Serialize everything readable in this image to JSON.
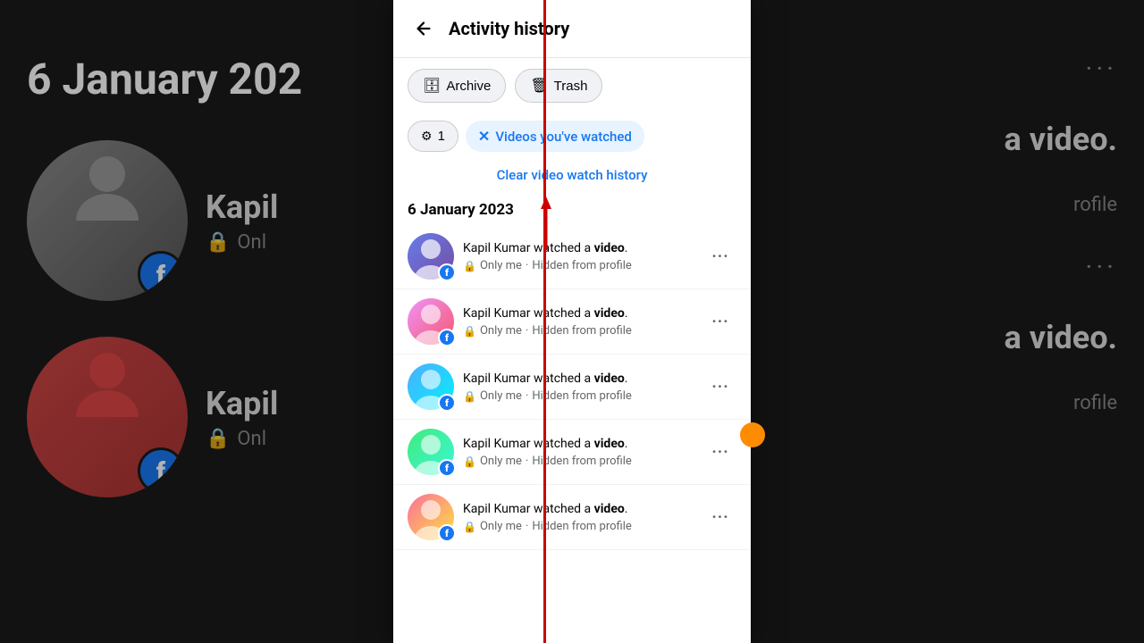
{
  "header": {
    "back_label": "←",
    "title": "Activity history"
  },
  "action_buttons": [
    {
      "id": "archive",
      "icon": "🗄",
      "label": "Archive"
    },
    {
      "id": "trash",
      "icon": "🗑",
      "label": "Trash"
    }
  ],
  "filter": {
    "count": "1",
    "filter_icon": "⚙",
    "tag_label": "Videos you've watched",
    "tag_x": "✕"
  },
  "clear_link": "Clear video watch history",
  "date_label": "6 January 2023",
  "activities": [
    {
      "id": 1,
      "text_prefix": "Kapil Kumar watched a",
      "text_bold": "video",
      "text_suffix": ".",
      "meta_lock": "🔒",
      "meta_visibility": "Only me",
      "meta_sep": "·",
      "meta_hidden": "Hidden from profile",
      "more": "···"
    },
    {
      "id": 2,
      "text_prefix": "Kapil Kumar watched a",
      "text_bold": "video",
      "text_suffix": ".",
      "meta_lock": "🔒",
      "meta_visibility": "Only me",
      "meta_sep": "·",
      "meta_hidden": "Hidden from profile",
      "more": "···"
    },
    {
      "id": 3,
      "text_prefix": "Kapil Kumar watched a",
      "text_bold": "video",
      "text_suffix": ".",
      "meta_lock": "🔒",
      "meta_visibility": "Only me",
      "meta_sep": "·",
      "meta_hidden": "Hidden from profile",
      "more": "···"
    },
    {
      "id": 4,
      "text_prefix": "Kapil Kumar watched a",
      "text_bold": "video",
      "text_suffix": ".",
      "meta_lock": "🔒",
      "meta_visibility": "Only me",
      "meta_sep": "·",
      "meta_hidden": "Hidden from profile",
      "more": "···"
    },
    {
      "id": 5,
      "text_prefix": "Kapil Kumar watched a",
      "text_bold": "video",
      "text_suffix": ".",
      "meta_lock": "🔒",
      "meta_visibility": "Only me",
      "meta_sep": "·",
      "meta_hidden": "Hidden from profile",
      "more": "···"
    }
  ],
  "bg": {
    "date_text": "6 January 202",
    "person_label": "Kapil",
    "video_text": "a video.",
    "only_text": "Onl",
    "profile_text": "rofile",
    "lock": "🔒"
  },
  "colors": {
    "accent": "#1877f2",
    "filter_bg": "#e7f3ff",
    "red_line": "#cc0000"
  }
}
